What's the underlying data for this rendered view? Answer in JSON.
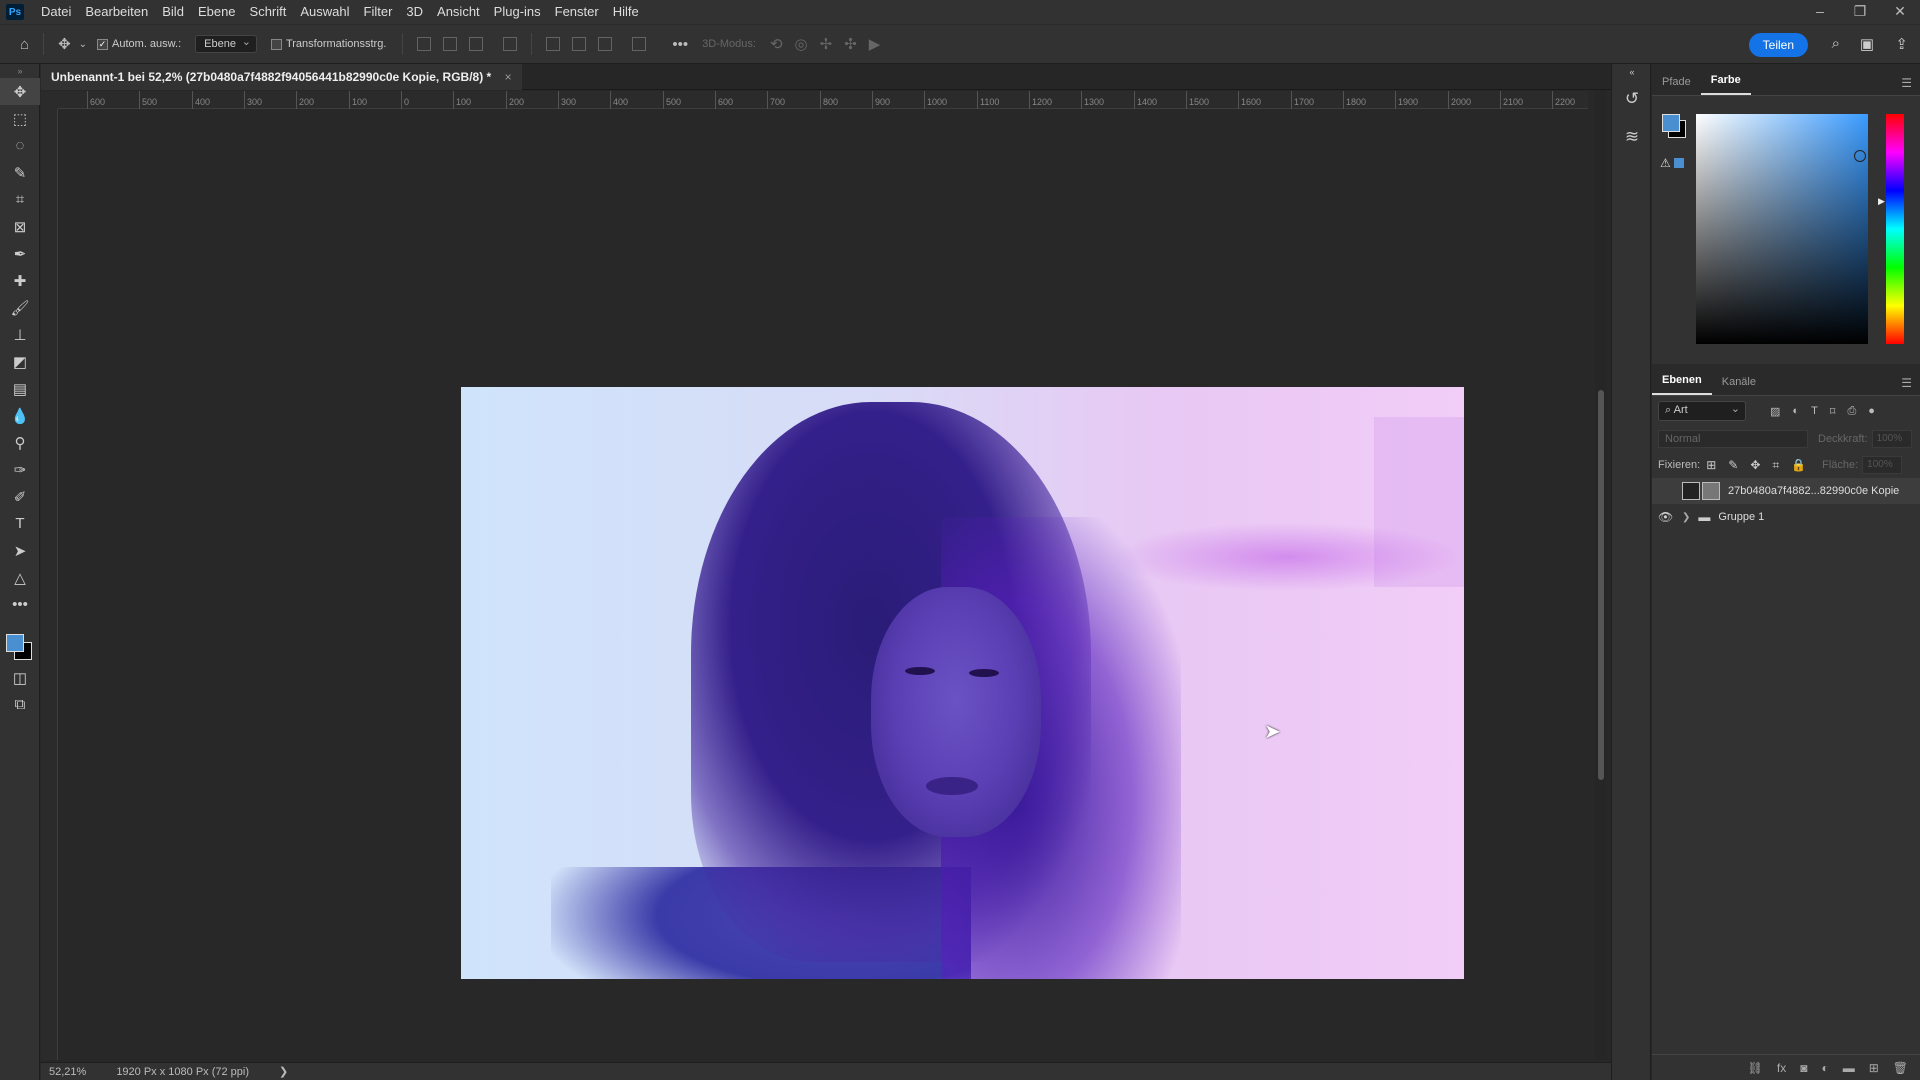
{
  "menubar": {
    "logo": "Ps",
    "items": [
      "Datei",
      "Bearbeiten",
      "Bild",
      "Ebene",
      "Schrift",
      "Auswahl",
      "Filter",
      "3D",
      "Ansicht",
      "Plug-ins",
      "Fenster",
      "Hilfe"
    ]
  },
  "options": {
    "auto_select_label": "Autom. ausw.:",
    "auto_select_target": "Ebene",
    "transform_label": "Transformationsstrg.",
    "mode_3d": "3D-Modus:",
    "share_label": "Teilen"
  },
  "document": {
    "tab_title": "Unbenannt-1 bei 52,2% (27b0480a7f4882f94056441b82990c0e Kopie, RGB/8) *",
    "close": "×"
  },
  "ruler": {
    "ticks": [
      "600",
      "500",
      "400",
      "300",
      "200",
      "100",
      "0",
      "100",
      "200",
      "300",
      "400",
      "500",
      "600",
      "700",
      "800",
      "900",
      "1000",
      "1100",
      "1200",
      "1300",
      "1400",
      "1500",
      "1600",
      "1700",
      "1800",
      "1900",
      "2000",
      "2100",
      "2200"
    ]
  },
  "status": {
    "zoom": "52,21%",
    "dimensions": "1920 Px x 1080 Px (72 ppi)",
    "arrow": "❯"
  },
  "color_panel": {
    "tabs": [
      "Pfade",
      "Farbe"
    ],
    "active_tab": "Farbe",
    "foreground_color": "#4a90d0",
    "background_color": "#000000"
  },
  "layers_panel": {
    "tabs": [
      "Ebenen",
      "Kanäle"
    ],
    "active_tab": "Ebenen",
    "filter_type": "Art",
    "blend_mode": "Normal",
    "opacity_label": "Deckkraft:",
    "opacity_value": "100%",
    "lock_label": "Fixieren:",
    "fill_label": "Fläche:",
    "fill_value": "100%",
    "layers": [
      {
        "name": "27b0480a7f4882...82990c0e Kopie",
        "visible": false,
        "selected": true,
        "type": "layer"
      },
      {
        "name": "Gruppe 1",
        "visible": true,
        "selected": false,
        "type": "group"
      }
    ]
  }
}
